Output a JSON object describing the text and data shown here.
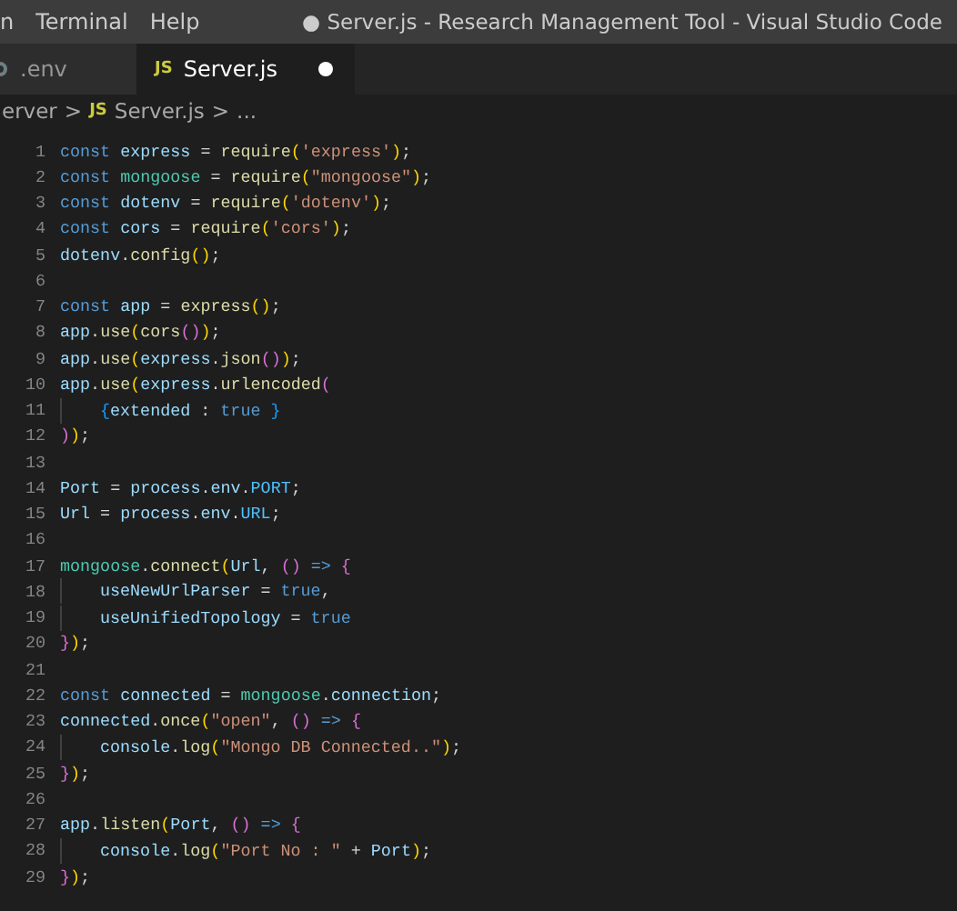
{
  "menu_bar": {
    "items": [
      "n",
      "Terminal",
      "Help"
    ]
  },
  "window": {
    "title": "● Server.js - Research Management Tool - Visual Studio Code"
  },
  "tabs": [
    {
      "label": ".env",
      "selected": false,
      "modified": false
    },
    {
      "label": "Server.js",
      "icon_text": "JS",
      "selected": true,
      "modified": true
    }
  ],
  "breadcrumb": {
    "folder": "erver",
    "separator_1": ">",
    "file_icon_text": "JS",
    "file": "Server.js",
    "separator_2": ">",
    "symbol": "..."
  },
  "editor": {
    "lines": [
      {
        "number": "1",
        "indent_guide": false,
        "tokens": [
          {
            "text": "const ",
            "kind": "kw"
          },
          {
            "text": "express",
            "kind": "var"
          },
          {
            "text": " = ",
            "kind": "op"
          },
          {
            "text": "require",
            "kind": "fn"
          },
          {
            "text": "(",
            "kind": "b1"
          },
          {
            "text": "'express'",
            "kind": "str"
          },
          {
            "text": ")",
            "kind": "b1"
          },
          {
            "text": ";",
            "kind": "op"
          }
        ]
      },
      {
        "number": "2",
        "indent_guide": false,
        "tokens": [
          {
            "text": "const ",
            "kind": "kw"
          },
          {
            "text": "mongoose",
            "kind": "cls"
          },
          {
            "text": " = ",
            "kind": "op"
          },
          {
            "text": "require",
            "kind": "fn"
          },
          {
            "text": "(",
            "kind": "b1"
          },
          {
            "text": "\"mongoose\"",
            "kind": "str"
          },
          {
            "text": ")",
            "kind": "b1"
          },
          {
            "text": ";",
            "kind": "op"
          }
        ]
      },
      {
        "number": "3",
        "indent_guide": false,
        "tokens": [
          {
            "text": "const ",
            "kind": "kw"
          },
          {
            "text": "dotenv",
            "kind": "var"
          },
          {
            "text": " = ",
            "kind": "op"
          },
          {
            "text": "require",
            "kind": "fn"
          },
          {
            "text": "(",
            "kind": "b1"
          },
          {
            "text": "'dotenv'",
            "kind": "str"
          },
          {
            "text": ")",
            "kind": "b1"
          },
          {
            "text": ";",
            "kind": "op"
          }
        ]
      },
      {
        "number": "4",
        "indent_guide": false,
        "tokens": [
          {
            "text": "const ",
            "kind": "kw"
          },
          {
            "text": "cors",
            "kind": "var"
          },
          {
            "text": " = ",
            "kind": "op"
          },
          {
            "text": "require",
            "kind": "fn"
          },
          {
            "text": "(",
            "kind": "b1"
          },
          {
            "text": "'cors'",
            "kind": "str"
          },
          {
            "text": ")",
            "kind": "b1"
          },
          {
            "text": ";",
            "kind": "op"
          }
        ]
      },
      {
        "number": "5",
        "indent_guide": false,
        "tokens": [
          {
            "text": "dotenv",
            "kind": "var"
          },
          {
            "text": ".",
            "kind": "op"
          },
          {
            "text": "config",
            "kind": "fn"
          },
          {
            "text": "()",
            "kind": "b1"
          },
          {
            "text": ";",
            "kind": "op"
          }
        ]
      },
      {
        "number": "6",
        "indent_guide": false
      },
      {
        "number": "7",
        "indent_guide": false,
        "tokens": [
          {
            "text": "const ",
            "kind": "kw"
          },
          {
            "text": "app",
            "kind": "var"
          },
          {
            "text": " = ",
            "kind": "op"
          },
          {
            "text": "express",
            "kind": "fn"
          },
          {
            "text": "()",
            "kind": "b1"
          },
          {
            "text": ";",
            "kind": "op"
          }
        ]
      },
      {
        "number": "8",
        "indent_guide": false,
        "tokens": [
          {
            "text": "app",
            "kind": "var"
          },
          {
            "text": ".",
            "kind": "op"
          },
          {
            "text": "use",
            "kind": "fn"
          },
          {
            "text": "(",
            "kind": "b1"
          },
          {
            "text": "cors",
            "kind": "fn"
          },
          {
            "text": "()",
            "kind": "b2"
          },
          {
            "text": ")",
            "kind": "b1"
          },
          {
            "text": ";",
            "kind": "op"
          }
        ]
      },
      {
        "number": "9",
        "indent_guide": false,
        "tokens": [
          {
            "text": "app",
            "kind": "var"
          },
          {
            "text": ".",
            "kind": "op"
          },
          {
            "text": "use",
            "kind": "fn"
          },
          {
            "text": "(",
            "kind": "b1"
          },
          {
            "text": "express",
            "kind": "var"
          },
          {
            "text": ".",
            "kind": "op"
          },
          {
            "text": "json",
            "kind": "fn"
          },
          {
            "text": "()",
            "kind": "b2"
          },
          {
            "text": ")",
            "kind": "b1"
          },
          {
            "text": ";",
            "kind": "op"
          }
        ]
      },
      {
        "number": "10",
        "indent_guide": false,
        "tokens": [
          {
            "text": "app",
            "kind": "var"
          },
          {
            "text": ".",
            "kind": "op"
          },
          {
            "text": "use",
            "kind": "fn"
          },
          {
            "text": "(",
            "kind": "b1"
          },
          {
            "text": "express",
            "kind": "var"
          },
          {
            "text": ".",
            "kind": "op"
          },
          {
            "text": "urlencoded",
            "kind": "fn"
          },
          {
            "text": "(",
            "kind": "b2"
          }
        ]
      },
      {
        "number": "11",
        "indent_guide": true,
        "tokens": [
          {
            "text": "{",
            "kind": "b3"
          },
          {
            "text": "extended",
            "kind": "var"
          },
          {
            "text": " : ",
            "kind": "op"
          },
          {
            "text": "true",
            "kind": "kw"
          },
          {
            "text": " }",
            "kind": "b3"
          }
        ]
      },
      {
        "number": "12",
        "indent_guide": false,
        "tokens": [
          {
            "text": ")",
            "kind": "b2"
          },
          {
            "text": ")",
            "kind": "b1"
          },
          {
            "text": ";",
            "kind": "op"
          }
        ]
      },
      {
        "number": "13",
        "indent_guide": false
      },
      {
        "number": "14",
        "indent_guide": false,
        "tokens": [
          {
            "text": "Port",
            "kind": "var"
          },
          {
            "text": " = ",
            "kind": "op"
          },
          {
            "text": "process",
            "kind": "var"
          },
          {
            "text": ".",
            "kind": "op"
          },
          {
            "text": "env",
            "kind": "var"
          },
          {
            "text": ".",
            "kind": "op"
          },
          {
            "text": "PORT",
            "kind": "const"
          },
          {
            "text": ";",
            "kind": "op"
          }
        ]
      },
      {
        "number": "15",
        "indent_guide": false,
        "tokens": [
          {
            "text": "Url",
            "kind": "var"
          },
          {
            "text": " = ",
            "kind": "op"
          },
          {
            "text": "process",
            "kind": "var"
          },
          {
            "text": ".",
            "kind": "op"
          },
          {
            "text": "env",
            "kind": "var"
          },
          {
            "text": ".",
            "kind": "op"
          },
          {
            "text": "URL",
            "kind": "const"
          },
          {
            "text": ";",
            "kind": "op"
          }
        ]
      },
      {
        "number": "16",
        "indent_guide": false
      },
      {
        "number": "17",
        "indent_guide": false,
        "tokens": [
          {
            "text": "mongoose",
            "kind": "cls"
          },
          {
            "text": ".",
            "kind": "op"
          },
          {
            "text": "connect",
            "kind": "fn"
          },
          {
            "text": "(",
            "kind": "b1"
          },
          {
            "text": "Url",
            "kind": "var"
          },
          {
            "text": ", ",
            "kind": "op"
          },
          {
            "text": "()",
            "kind": "b2"
          },
          {
            "text": " => ",
            "kind": "kw"
          },
          {
            "text": "{",
            "kind": "b2"
          }
        ]
      },
      {
        "number": "18",
        "indent_guide": true,
        "tokens": [
          {
            "text": "useNewUrlParser",
            "kind": "var"
          },
          {
            "text": " = ",
            "kind": "op"
          },
          {
            "text": "true",
            "kind": "kw"
          },
          {
            "text": ",",
            "kind": "op"
          }
        ]
      },
      {
        "number": "19",
        "indent_guide": true,
        "tokens": [
          {
            "text": "useUnifiedTopology",
            "kind": "var"
          },
          {
            "text": " = ",
            "kind": "op"
          },
          {
            "text": "true",
            "kind": "kw"
          }
        ]
      },
      {
        "number": "20",
        "indent_guide": false,
        "tokens": [
          {
            "text": "}",
            "kind": "b2"
          },
          {
            "text": ")",
            "kind": "b1"
          },
          {
            "text": ";",
            "kind": "op"
          }
        ]
      },
      {
        "number": "21",
        "indent_guide": false
      },
      {
        "number": "22",
        "indent_guide": false,
        "tokens": [
          {
            "text": "const ",
            "kind": "kw"
          },
          {
            "text": "connected",
            "kind": "var"
          },
          {
            "text": " = ",
            "kind": "op"
          },
          {
            "text": "mongoose",
            "kind": "cls"
          },
          {
            "text": ".",
            "kind": "op"
          },
          {
            "text": "connection",
            "kind": "var"
          },
          {
            "text": ";",
            "kind": "op"
          }
        ]
      },
      {
        "number": "23",
        "indent_guide": false,
        "tokens": [
          {
            "text": "connected",
            "kind": "var"
          },
          {
            "text": ".",
            "kind": "op"
          },
          {
            "text": "once",
            "kind": "fn"
          },
          {
            "text": "(",
            "kind": "b1"
          },
          {
            "text": "\"open\"",
            "kind": "str"
          },
          {
            "text": ", ",
            "kind": "op"
          },
          {
            "text": "()",
            "kind": "b2"
          },
          {
            "text": " => ",
            "kind": "kw"
          },
          {
            "text": "{",
            "kind": "b2"
          }
        ]
      },
      {
        "number": "24",
        "indent_guide": true,
        "tokens": [
          {
            "text": "console",
            "kind": "var"
          },
          {
            "text": ".",
            "kind": "op"
          },
          {
            "text": "log",
            "kind": "fn"
          },
          {
            "text": "(",
            "kind": "b1"
          },
          {
            "text": "\"Mongo DB Connected..\"",
            "kind": "str"
          },
          {
            "text": ")",
            "kind": "b1"
          },
          {
            "text": ";",
            "kind": "op"
          }
        ]
      },
      {
        "number": "25",
        "indent_guide": false,
        "tokens": [
          {
            "text": "}",
            "kind": "b2"
          },
          {
            "text": ")",
            "kind": "b1"
          },
          {
            "text": ";",
            "kind": "op"
          }
        ]
      },
      {
        "number": "26",
        "indent_guide": false
      },
      {
        "number": "27",
        "indent_guide": false,
        "tokens": [
          {
            "text": "app",
            "kind": "var"
          },
          {
            "text": ".",
            "kind": "op"
          },
          {
            "text": "listen",
            "kind": "fn"
          },
          {
            "text": "(",
            "kind": "b1"
          },
          {
            "text": "Port",
            "kind": "var"
          },
          {
            "text": ", ",
            "kind": "op"
          },
          {
            "text": "()",
            "kind": "b2"
          },
          {
            "text": " => ",
            "kind": "kw"
          },
          {
            "text": "{",
            "kind": "b2"
          }
        ]
      },
      {
        "number": "28",
        "indent_guide": true,
        "tokens": [
          {
            "text": "console",
            "kind": "var"
          },
          {
            "text": ".",
            "kind": "op"
          },
          {
            "text": "log",
            "kind": "fn"
          },
          {
            "text": "(",
            "kind": "b1"
          },
          {
            "text": "\"Port No : \"",
            "kind": "str"
          },
          {
            "text": " + ",
            "kind": "op"
          },
          {
            "text": "Port",
            "kind": "var"
          },
          {
            "text": ")",
            "kind": "b1"
          },
          {
            "text": ";",
            "kind": "op"
          }
        ]
      },
      {
        "number": "29",
        "indent_guide": false,
        "tokens": [
          {
            "text": "}",
            "kind": "b2"
          },
          {
            "text": ")",
            "kind": "b1"
          },
          {
            "text": ";",
            "kind": "op"
          }
        ]
      }
    ]
  }
}
